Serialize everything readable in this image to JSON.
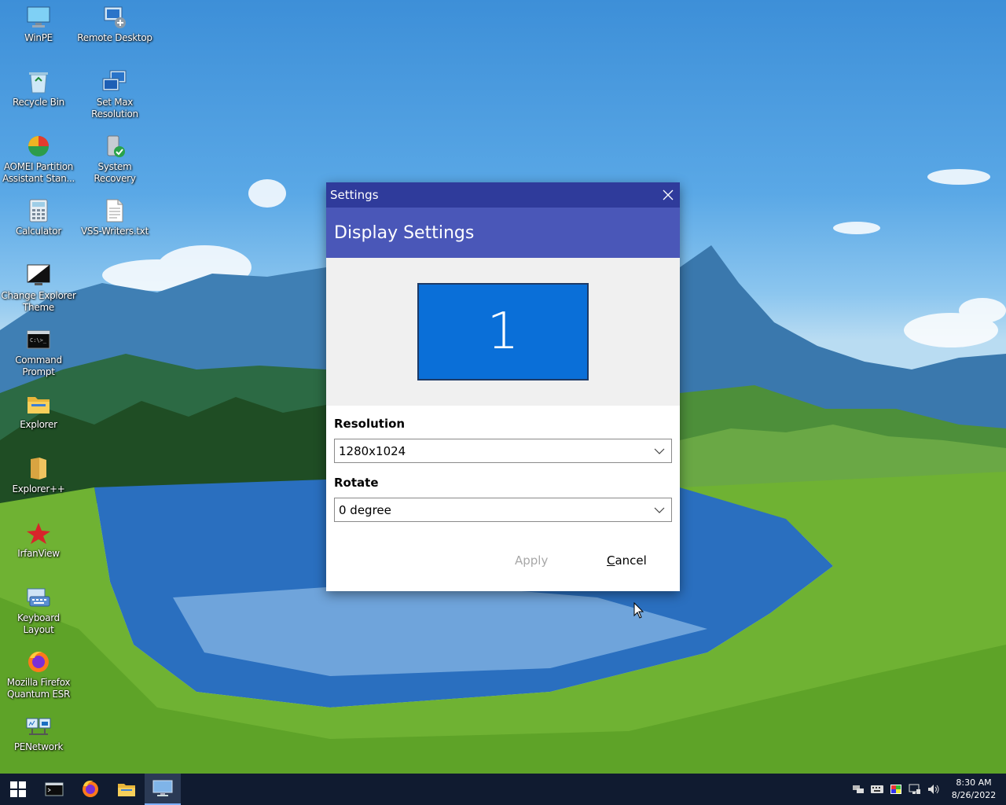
{
  "desktop": {
    "icons": [
      {
        "label": "WinPE",
        "icon": "monitor-icon"
      },
      {
        "label": "Remote Desktop",
        "icon": "remote-desktop-icon"
      },
      {
        "label": "Recycle Bin",
        "icon": "recycle-bin-icon"
      },
      {
        "label": "Set Max\nResolution",
        "icon": "set-resolution-icon"
      },
      {
        "label": "AOMEI Partition\nAssistant Stan...",
        "icon": "aomei-icon"
      },
      {
        "label": "System Recovery",
        "icon": "system-recovery-icon"
      },
      {
        "label": "Calculator",
        "icon": "calculator-icon"
      },
      {
        "label": "VSS-Writers.txt",
        "icon": "text-file-icon"
      },
      {
        "label": "Change Explorer\nTheme",
        "icon": "theme-icon"
      },
      {
        "label": "Command\nPrompt",
        "icon": "cmd-icon"
      },
      {
        "label": "Explorer",
        "icon": "folder-icon"
      },
      {
        "label": "Explorer++",
        "icon": "explorerpp-icon"
      },
      {
        "label": "IrfanView",
        "icon": "irfanview-icon"
      },
      {
        "label": "Keyboard Layout",
        "icon": "keyboard-icon"
      },
      {
        "label": "Mozilla Firefox\nQuantum ESR",
        "icon": "firefox-icon"
      },
      {
        "label": "PENetwork",
        "icon": "network-icon"
      }
    ]
  },
  "dialog": {
    "title": "Settings",
    "header": "Display Settings",
    "monitor_number": "1",
    "resolution": {
      "label": "Resolution",
      "value": "1280x1024"
    },
    "rotate": {
      "label": "Rotate",
      "value": "0 degree"
    },
    "apply_label": "Apply",
    "cancel_label_first": "C",
    "cancel_label_rest": "ancel"
  },
  "taskbar": {
    "time": "8:30 AM",
    "date": "8/26/2022"
  },
  "colors": {
    "titlebar": "#2f3b9b",
    "header": "#4a57b8",
    "monitor": "#0a6fd8",
    "taskbar": "#101b30"
  }
}
